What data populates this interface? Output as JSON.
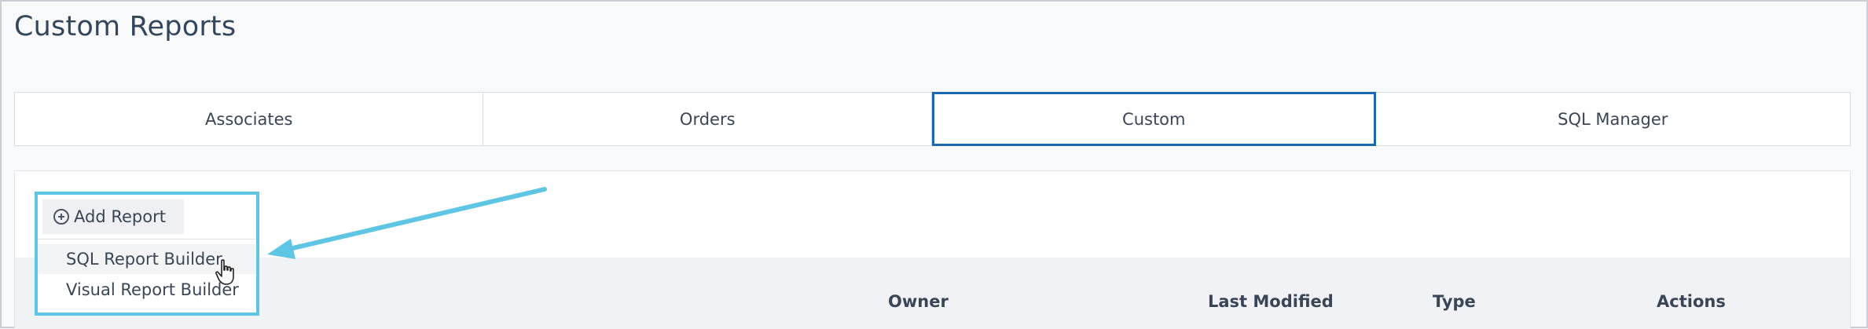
{
  "page": {
    "title": "Custom Reports"
  },
  "tabs": [
    {
      "label": "Associates",
      "active": false
    },
    {
      "label": "Orders",
      "active": false
    },
    {
      "label": "Custom",
      "active": true
    },
    {
      "label": "SQL Manager",
      "active": false
    }
  ],
  "toolbar": {
    "add_report_label": "Add Report",
    "add_icon": "plus-circle-icon"
  },
  "add_menu": {
    "items": [
      {
        "label": "SQL Report Builder"
      },
      {
        "label": "Visual Report Builder"
      }
    ]
  },
  "table": {
    "columns": [
      "Owner",
      "Last Modified",
      "Type",
      "Actions"
    ]
  },
  "colors": {
    "accent": "#1b68b0",
    "annotation": "#5ec6e4",
    "title": "#34465c"
  }
}
